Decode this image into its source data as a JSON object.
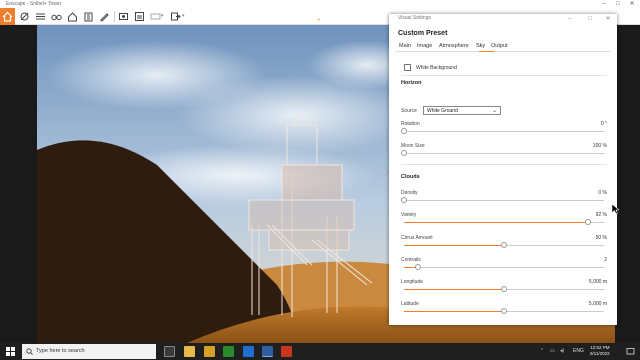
{
  "window": {
    "title": "Enscape - Snibel+ Tower"
  },
  "toolbar": {
    "icons": [
      "home-icon",
      "orbit-icon",
      "layers-icon",
      "binoculars-icon",
      "house-icon",
      "building-icon",
      "pencil-icon",
      "screenshot-icon",
      "batch-render-icon",
      "panorama-icon",
      "export-icon"
    ]
  },
  "panel": {
    "title": "Visual Settings",
    "preset_name": "Custom Preset",
    "tabs": [
      "Main",
      "Image",
      "Atmosphere",
      "Sky",
      "Output"
    ],
    "active_tab": "Sky",
    "white_background_label": "White Background",
    "white_background_checked": false,
    "horizon": {
      "heading": "Horizon",
      "source_label": "Source",
      "source_value": "White Ground",
      "rotation_label": "Rotation",
      "rotation_value": "0 °",
      "rotation_fraction": 0,
      "moon_size_label": "Moon Size",
      "moon_size_value": "100 %",
      "moon_size_fraction": 0
    },
    "clouds": {
      "heading": "Clouds",
      "density_label": "Density",
      "density_value": "0 %",
      "density_fraction": 0,
      "variety_label": "Variety",
      "variety_value": "92 %",
      "variety_fraction": 0.92,
      "cirrus_label": "Cirrus Amount",
      "cirrus_value": "50 %",
      "cirrus_fraction": 0.5,
      "contrails_label": "Contrails",
      "contrails_value": "2",
      "contrails_fraction": 0.07,
      "longitude_label": "Longitude",
      "longitude_value": "5,000 m",
      "longitude_fraction": 0.5,
      "latitude_label": "Latitude",
      "latitude_value": "5,000 m",
      "latitude_fraction": 0.5
    }
  },
  "taskbar": {
    "search_placeholder": "Type here to search",
    "tray_lang": "ENG",
    "time": "12:52 PM",
    "date": "9/11/2022"
  },
  "colors": {
    "accent": "#f07f2d",
    "panel_bg": "#ffffff",
    "taskbar_bg": "#1f1f1f"
  }
}
